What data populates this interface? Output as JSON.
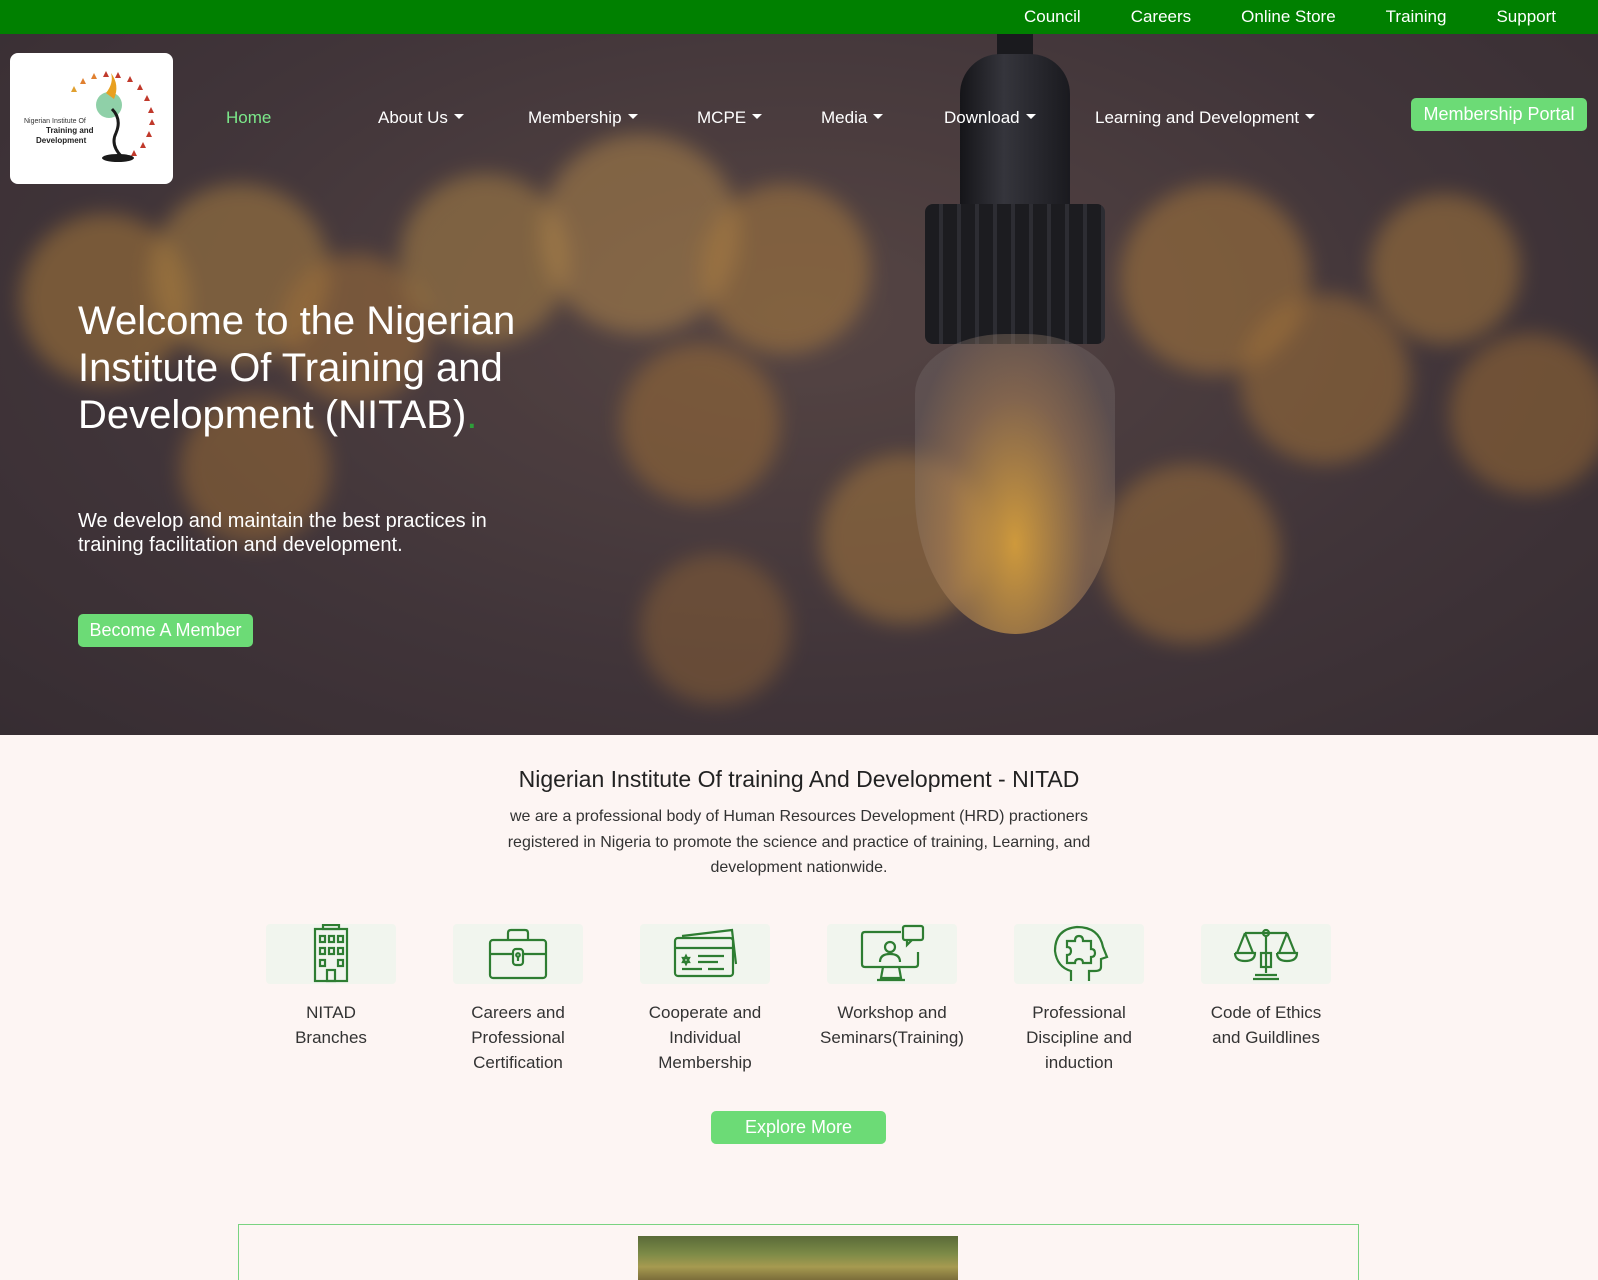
{
  "topbar": {
    "links": [
      "Council",
      "Careers",
      "Online Store",
      "Training",
      "Support"
    ],
    "bg_color": "#008000"
  },
  "logo": {
    "line1": "Nigerian Institute Of",
    "line2": "Training and",
    "line3": "Development"
  },
  "nav": {
    "items": [
      {
        "label": "Home",
        "dropdown": false,
        "active": true
      },
      {
        "label": "About Us",
        "dropdown": true
      },
      {
        "label": "Membership",
        "dropdown": true
      },
      {
        "label": "MCPE",
        "dropdown": true
      },
      {
        "label": "Media",
        "dropdown": true
      },
      {
        "label": "Download",
        "dropdown": true
      },
      {
        "label": "Learning and Development",
        "dropdown": true
      }
    ],
    "portal_label": "Membership Portal"
  },
  "hero": {
    "title": "Welcome to the Nigerian Institute Of Training and Development (NITAB)",
    "title_dot": ".",
    "subtitle": "We develop and maintain the best practices in training facilitation and development.",
    "cta_label": "Become A Member"
  },
  "about": {
    "title": "Nigerian Institute Of training And Development - NITAD",
    "description": "we are a professional body of Human Resources Development (HRD) practioners registered in Nigeria to promote the science and practice of training, Learning, and development nationwide."
  },
  "features": [
    {
      "icon": "building-icon",
      "label": "NITAD Branches"
    },
    {
      "icon": "briefcase-icon",
      "label": "Careers and Professional Certification"
    },
    {
      "icon": "id-card-icon",
      "label": "Cooperate and Individual Membership"
    },
    {
      "icon": "computer-user-chat-icon",
      "label": "Workshop and Seminars(Training)"
    },
    {
      "icon": "head-puzzle-icon",
      "label": "Professional Discipline and induction"
    },
    {
      "icon": "scales-icon",
      "label": "Code of Ethics and Guildlines"
    }
  ],
  "explore_label": "Explore More",
  "colors": {
    "accent_green": "#6cdb76",
    "brand_green": "#008000",
    "icon_green": "#2e7d32",
    "page_bg": "#fdf5f3"
  }
}
